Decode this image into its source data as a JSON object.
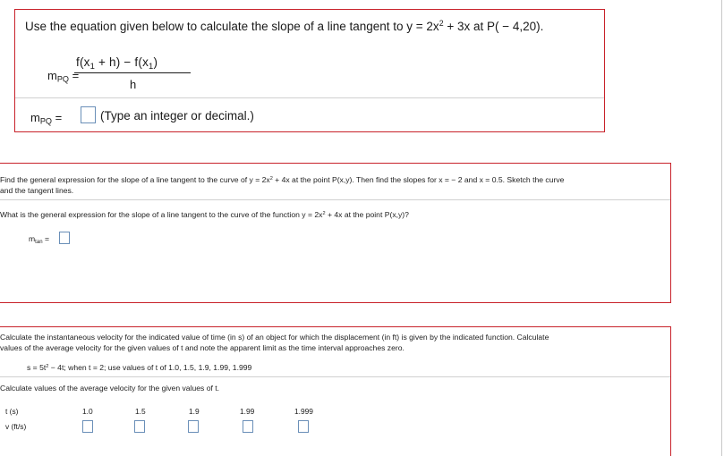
{
  "q1": {
    "prompt_prefix": "Use the equation given below to calculate the slope of a line tangent to y = 2x",
    "prompt_exp": "2",
    "prompt_suffix": " + 3x at P( − 4,20).",
    "m_symbol": "m",
    "m_sub": "PQ",
    "eq": "=",
    "numerator_f1": "f(x",
    "numerator_sub1": "1",
    "numerator_mid": " + h) − f(x",
    "numerator_sub2": "1",
    "numerator_end": ")",
    "denominator": "h",
    "answer_hint": "(Type an integer or decimal.)"
  },
  "q2": {
    "line1_prefix": "Find the general expression for the slope of a line tangent to the curve of y = 2x",
    "line1_exp": "2",
    "line1_suffix": " + 4x at the point P(x,y). Then find the slopes for x = − 2 and x = 0.5. Sketch the curve",
    "line2": "and the tangent lines.",
    "sub_prefix": "What is the general expression for the slope of a line tangent to the curve of the function  y = 2x",
    "sub_exp": "2",
    "sub_suffix": " + 4x at the point P(x,y)?",
    "m_symbol": "m",
    "m_sub": "tan",
    "eq": "="
  },
  "q3": {
    "line1": "Calculate the instantaneous velocity for the indicated value of time (in s) of an object for which the displacement (in ft) is given by the indicated function. Calculate",
    "line2": "values of the average velocity for the given values of t and note the apparent limit as the time interval approaches zero.",
    "func_prefix": "s = 5t",
    "func_exp": "2",
    "func_suffix": " − 4t; when t = 2; use values of t of 1.0, 1.5, 1.9, 1.99, 1.999",
    "sub_prompt": "Calculate values of the average velocity for the given values of t.",
    "row_t_label": "t (s)",
    "row_v_label": "v (ft/s)",
    "t_values": [
      "1.0",
      "1.5",
      "1.9",
      "1.99",
      "1.999"
    ]
  }
}
